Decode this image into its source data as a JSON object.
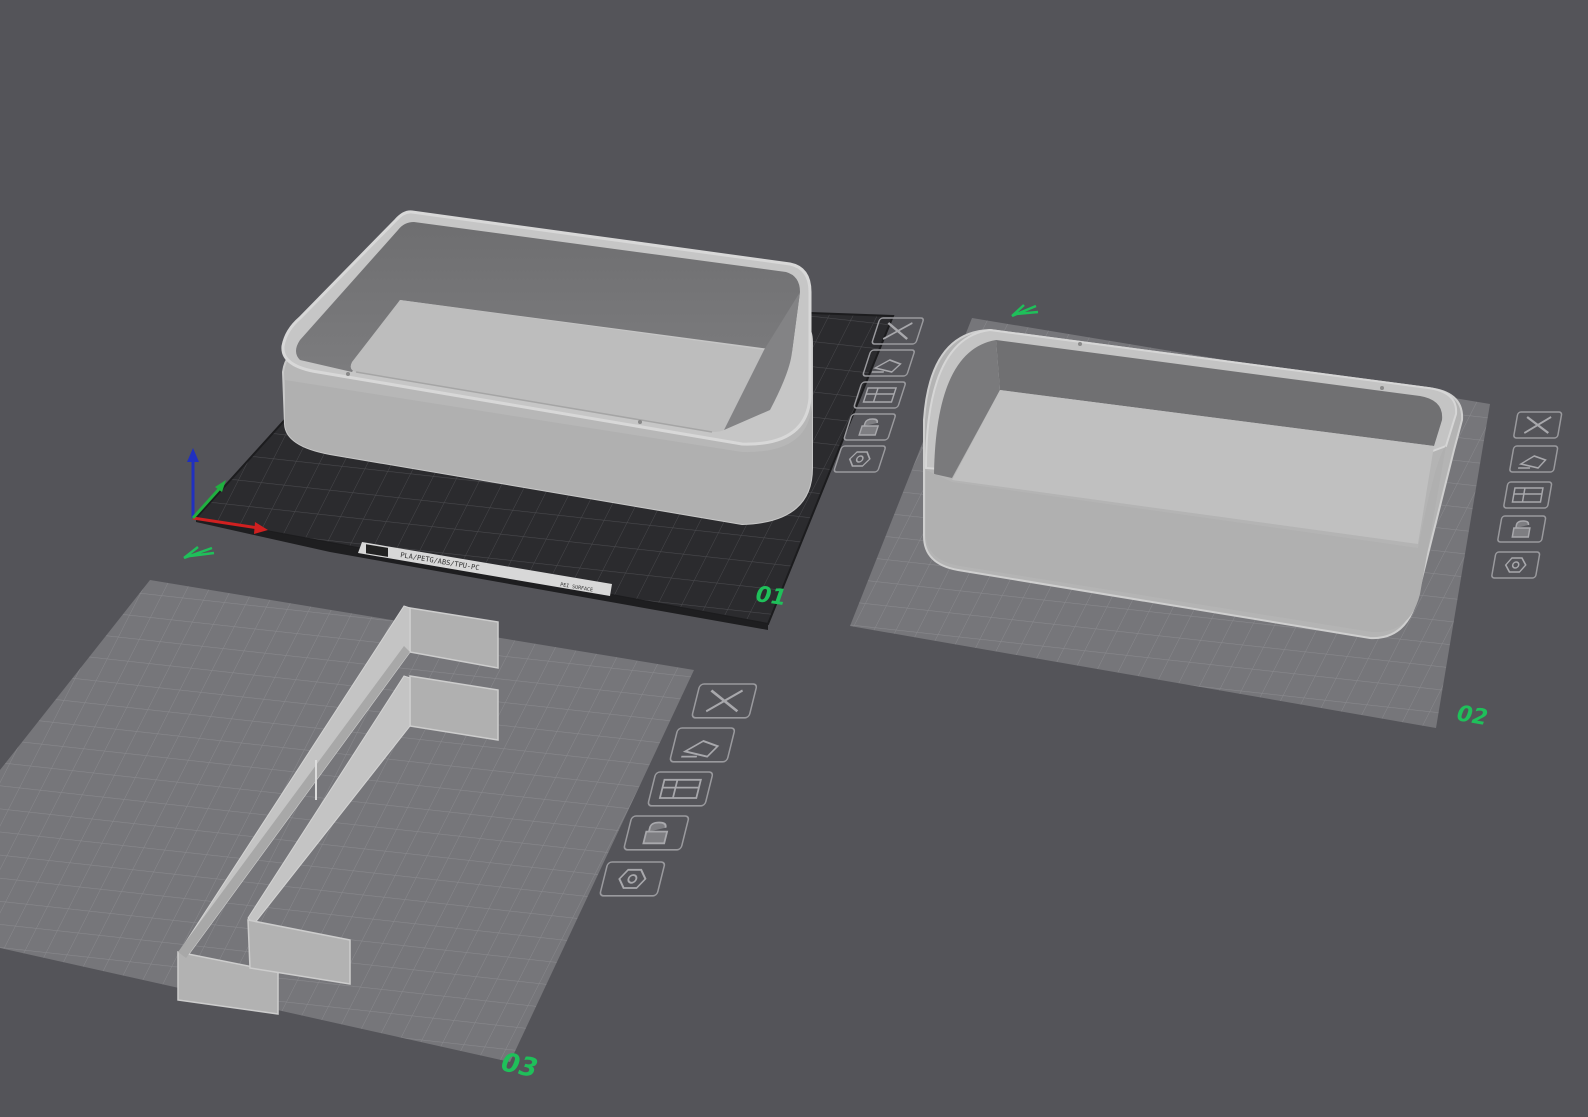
{
  "viewport": {
    "background_color": "#545459"
  },
  "colors": {
    "plate_label": "#1fc05a",
    "textured_plate": "#2a2a2d",
    "inactive_plate": "#7a7a7e",
    "model_gray": "#bdbdbd",
    "axis_x": "#d02020",
    "axis_y": "#20b040",
    "axis_z": "#2030c0"
  },
  "plates": [
    {
      "label": "01",
      "state": "active",
      "buttons": [
        "close-icon",
        "auto-orient-icon",
        "arrange-icon",
        "lock-icon",
        "plate-settings-icon"
      ]
    },
    {
      "label": "02",
      "state": "inactive",
      "buttons": [
        "close-icon",
        "auto-orient-icon",
        "arrange-icon",
        "lock-icon",
        "plate-settings-icon"
      ]
    },
    {
      "label": "03",
      "state": "inactive",
      "buttons": [
        "close-icon",
        "auto-orient-icon",
        "arrange-icon",
        "lock-icon",
        "plate-settings-icon"
      ]
    }
  ],
  "bed_strip": {
    "line1": "PLA/PETG/ABS/TPU-PC",
    "line2": "PEI SURFACE"
  }
}
